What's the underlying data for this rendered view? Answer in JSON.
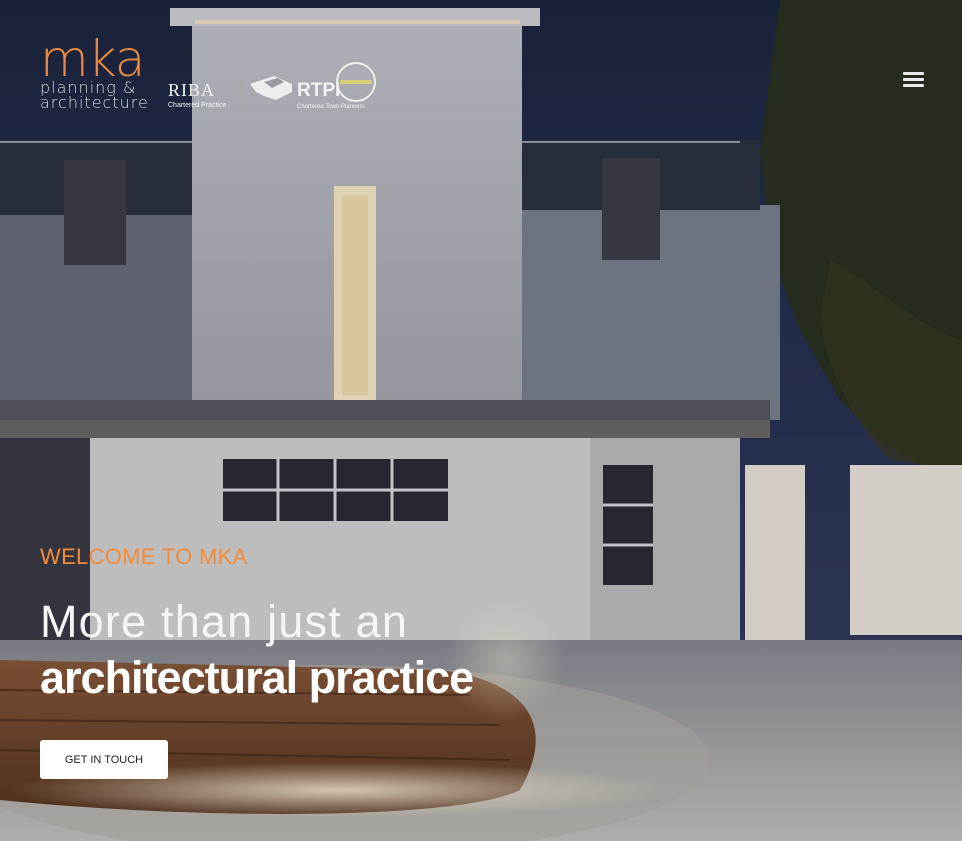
{
  "brand": {
    "logo_mark": "mka",
    "logo_line1": "planning &",
    "logo_line2": "architecture",
    "accent": "#e98a3f"
  },
  "affiliations": [
    {
      "mark": "RIBA",
      "caption": "Chartered Practice"
    },
    {
      "mark": "RTPI",
      "caption": "Chartered Town Planners"
    }
  ],
  "nav": {
    "menu_icon": "hamburger-icon"
  },
  "hero": {
    "eyebrow": "WELCOME TO MKA",
    "headline_line1": "More than just an",
    "headline_line2": "architectural practice",
    "cta_label": "GET IN TOUCH",
    "eyebrow_color": "#f28c39"
  }
}
